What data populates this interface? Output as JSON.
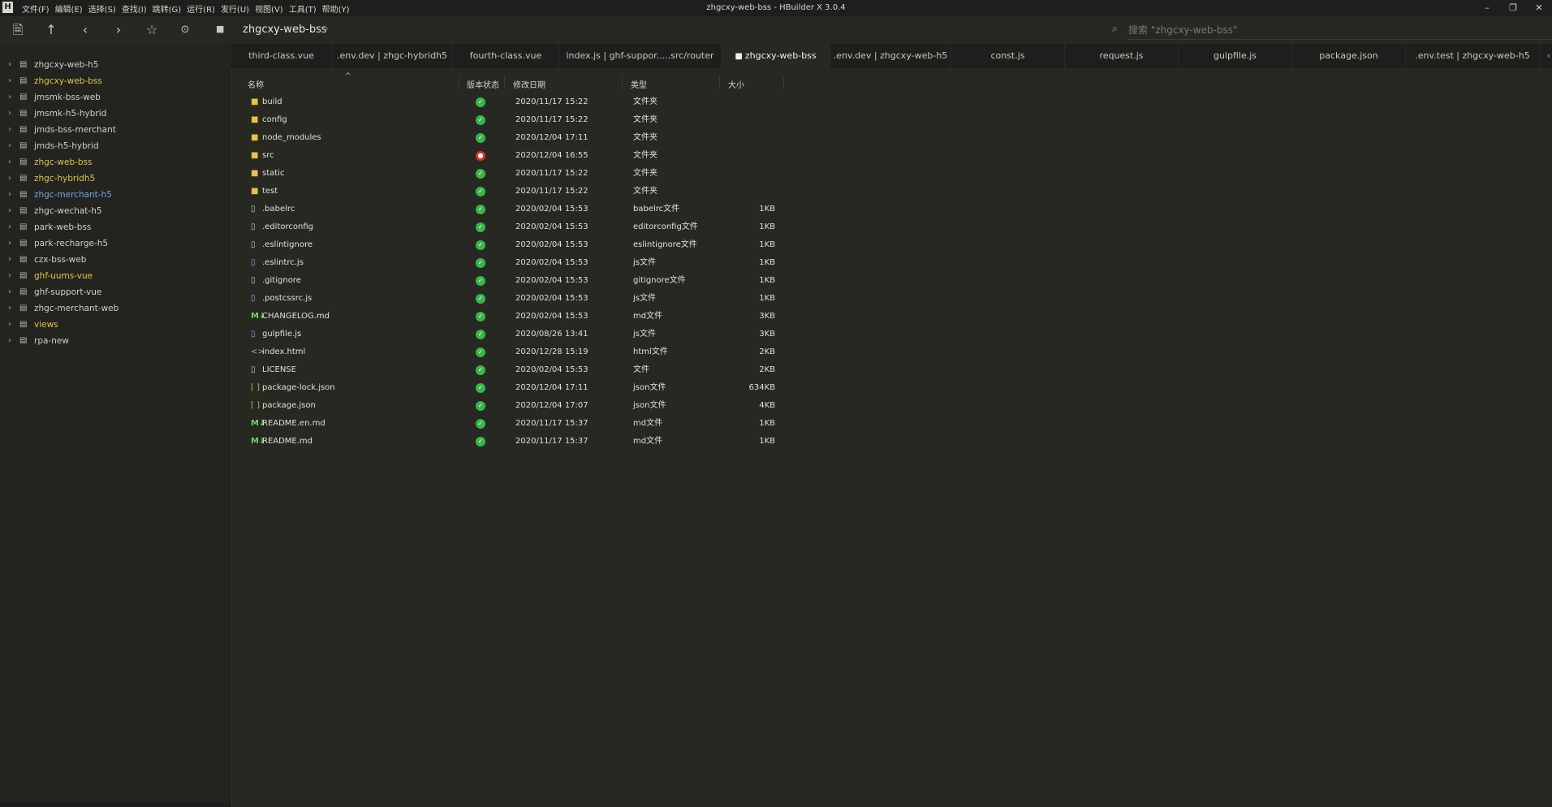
{
  "window": {
    "title": "zhgcxy-web-bss - HBuilder X 3.0.4",
    "logo": "H",
    "menu": [
      "文件(F)",
      "编辑(E)",
      "选择(S)",
      "查找(I)",
      "跳转(G)",
      "运行(R)",
      "发行(U)",
      "视图(V)",
      "工具(T)",
      "帮助(Y)"
    ],
    "controls": {
      "minimize": "–",
      "restore": "❐",
      "close": "✕"
    }
  },
  "toolbar": {
    "icons": [
      "save-all-icon",
      "up-icon",
      "back-icon",
      "forward-icon",
      "star-icon",
      "run-icon"
    ],
    "breadcrumb": "zhgcxy-web-bss",
    "search_placeholder": "搜索 \"zhgcxy-web-bss\""
  },
  "sidebar": {
    "items": [
      {
        "label": "zhgcxy-web-h5",
        "color": "#d0d0c8"
      },
      {
        "label": "zhgcxy-web-bss",
        "color": "#e6c24a"
      },
      {
        "label": "jmsmk-bss-web",
        "color": "#d0d0c8"
      },
      {
        "label": "jmsmk-h5-hybrid",
        "color": "#d0d0c8"
      },
      {
        "label": "jmds-bss-merchant",
        "color": "#d0d0c8"
      },
      {
        "label": "jmds-h5-hybrid",
        "color": "#d0d0c8"
      },
      {
        "label": "zhgc-web-bss",
        "color": "#e6c24a"
      },
      {
        "label": "zhgc-hybridh5",
        "color": "#e6c24a"
      },
      {
        "label": "zhgc-merchant-h5",
        "color": "#6fa8dc"
      },
      {
        "label": "zhgc-wechat-h5",
        "color": "#d0d0c8"
      },
      {
        "label": "park-web-bss",
        "color": "#d0d0c8"
      },
      {
        "label": "park-recharge-h5",
        "color": "#d0d0c8"
      },
      {
        "label": "czx-bss-web",
        "color": "#d0d0c8"
      },
      {
        "label": "ghf-uums-vue",
        "color": "#e6c24a"
      },
      {
        "label": "ghf-support-vue",
        "color": "#d0d0c8"
      },
      {
        "label": "zhgc-merchant-web",
        "color": "#d0d0c8"
      },
      {
        "label": "views",
        "color": "#e6c24a"
      },
      {
        "label": "rpa-new",
        "color": "#d0d0c8"
      }
    ]
  },
  "tabs": [
    {
      "label": "third-class.vue",
      "active": false
    },
    {
      "label": ".env.dev | zhgc-hybridh5",
      "active": false
    },
    {
      "label": "fourth-class.vue",
      "active": false
    },
    {
      "label": "index.js | ghf-suppor.....src/router",
      "active": false
    },
    {
      "label": "zhgcxy-web-bss",
      "active": true
    },
    {
      "label": ".env.dev | zhgcxy-web-h5",
      "active": false
    },
    {
      "label": "const.js",
      "active": false
    },
    {
      "label": "request.js",
      "active": false
    },
    {
      "label": "gulpfile.js",
      "active": false
    },
    {
      "label": "package.json",
      "active": false
    },
    {
      "label": ".env.test | zhgcxy-web-h5",
      "active": false
    }
  ],
  "table": {
    "headers": {
      "name": "名称",
      "status": "版本状态",
      "date": "修改日期",
      "type": "类型",
      "size": "大小"
    },
    "rows": [
      {
        "icon": "folder",
        "name": "build",
        "status": "ok",
        "date": "2020/11/17 15:22",
        "type": "文件夹",
        "size": ""
      },
      {
        "icon": "folder",
        "name": "config",
        "status": "ok",
        "date": "2020/11/17 15:22",
        "type": "文件夹",
        "size": ""
      },
      {
        "icon": "folder",
        "name": "node_modules",
        "status": "ok",
        "date": "2020/12/04 17:11",
        "type": "文件夹",
        "size": ""
      },
      {
        "icon": "folder",
        "name": "src",
        "status": "modified",
        "date": "2020/12/04 16:55",
        "type": "文件夹",
        "size": ""
      },
      {
        "icon": "folder",
        "name": "static",
        "status": "ok",
        "date": "2020/11/17 15:22",
        "type": "文件夹",
        "size": ""
      },
      {
        "icon": "folder",
        "name": "test",
        "status": "ok",
        "date": "2020/11/17 15:22",
        "type": "文件夹",
        "size": ""
      },
      {
        "icon": "file",
        "name": ".babelrc",
        "status": "ok",
        "date": "2020/02/04 15:53",
        "type": "babelrc文件",
        "size": "1KB"
      },
      {
        "icon": "file",
        "name": ".editorconfig",
        "status": "ok",
        "date": "2020/02/04 15:53",
        "type": "editorconfig文件",
        "size": "1KB"
      },
      {
        "icon": "file",
        "name": ".eslintignore",
        "status": "ok",
        "date": "2020/02/04 15:53",
        "type": "eslintignore文件",
        "size": "1KB"
      },
      {
        "icon": "js",
        "name": ".eslintrc.js",
        "status": "ok",
        "date": "2020/02/04 15:53",
        "type": "js文件",
        "size": "1KB"
      },
      {
        "icon": "file",
        "name": ".gitignore",
        "status": "ok",
        "date": "2020/02/04 15:53",
        "type": "gitignore文件",
        "size": "1KB"
      },
      {
        "icon": "js",
        "name": ".postcssrc.js",
        "status": "ok",
        "date": "2020/02/04 15:53",
        "type": "js文件",
        "size": "1KB"
      },
      {
        "icon": "md",
        "name": "CHANGELOG.md",
        "status": "ok",
        "date": "2020/02/04 15:53",
        "type": "md文件",
        "size": "3KB"
      },
      {
        "icon": "js",
        "name": "gulpfile.js",
        "status": "ok",
        "date": "2020/08/26 13:41",
        "type": "js文件",
        "size": "3KB"
      },
      {
        "icon": "html",
        "name": "index.html",
        "status": "ok",
        "date": "2020/12/28 15:19",
        "type": "html文件",
        "size": "2KB"
      },
      {
        "icon": "file",
        "name": "LICENSE",
        "status": "ok",
        "date": "2020/02/04 15:53",
        "type": "文件",
        "size": "2KB"
      },
      {
        "icon": "json",
        "name": "package-lock.json",
        "status": "ok",
        "date": "2020/12/04 17:11",
        "type": "json文件",
        "size": "634KB"
      },
      {
        "icon": "json",
        "name": "package.json",
        "status": "ok",
        "date": "2020/12/04 17:07",
        "type": "json文件",
        "size": "4KB"
      },
      {
        "icon": "md",
        "name": "README.en.md",
        "status": "ok",
        "date": "2020/11/17 15:37",
        "type": "md文件",
        "size": "1KB"
      },
      {
        "icon": "md",
        "name": "README.md",
        "status": "ok",
        "date": "2020/11/17 15:37",
        "type": "md文件",
        "size": "1KB"
      }
    ]
  }
}
